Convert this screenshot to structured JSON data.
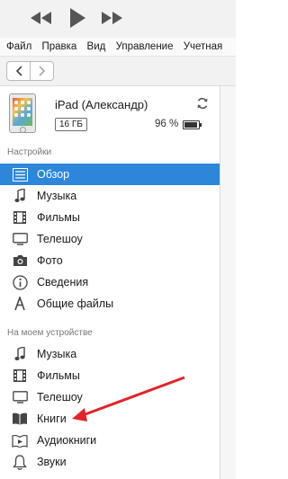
{
  "titlebar": {
    "controls": [
      {
        "name": "rewind-icon"
      },
      {
        "name": "play-icon"
      },
      {
        "name": "fast-forward-icon"
      }
    ]
  },
  "menu": [
    "Файл",
    "Правка",
    "Вид",
    "Управление",
    "Учетная"
  ],
  "navigation": {
    "back_icon": "chevron-left-icon",
    "forward_icon": "chevron-right-icon"
  },
  "device": {
    "name": "iPad (Александр)",
    "capacity": "16 ГБ",
    "battery_percent": "96 %",
    "battery_level": 0.96,
    "sync_icon": "sync-icon"
  },
  "sections": {
    "settings": {
      "title": "Настройки",
      "items": [
        {
          "label": "Обзор",
          "icon": "summary-list-icon",
          "selected": true
        },
        {
          "label": "Музыка",
          "icon": "music-note-icon"
        },
        {
          "label": "Фильмы",
          "icon": "film-icon"
        },
        {
          "label": "Телешоу",
          "icon": "tv-icon"
        },
        {
          "label": "Фото",
          "icon": "camera-icon"
        },
        {
          "label": "Сведения",
          "icon": "info-icon"
        },
        {
          "label": "Общие файлы",
          "icon": "apps-icon"
        }
      ]
    },
    "on_device": {
      "title": "На моем устройстве",
      "items": [
        {
          "label": "Музыка",
          "icon": "music-note-icon"
        },
        {
          "label": "Фильмы",
          "icon": "film-icon"
        },
        {
          "label": "Телешоу",
          "icon": "tv-icon"
        },
        {
          "label": "Книги",
          "icon": "book-icon"
        },
        {
          "label": "Аудиокниги",
          "icon": "audiobook-icon"
        },
        {
          "label": "Звуки",
          "icon": "bell-icon"
        }
      ]
    }
  },
  "colors": {
    "selection": "#2d86d9",
    "annotation_arrow": "#e0252b"
  }
}
